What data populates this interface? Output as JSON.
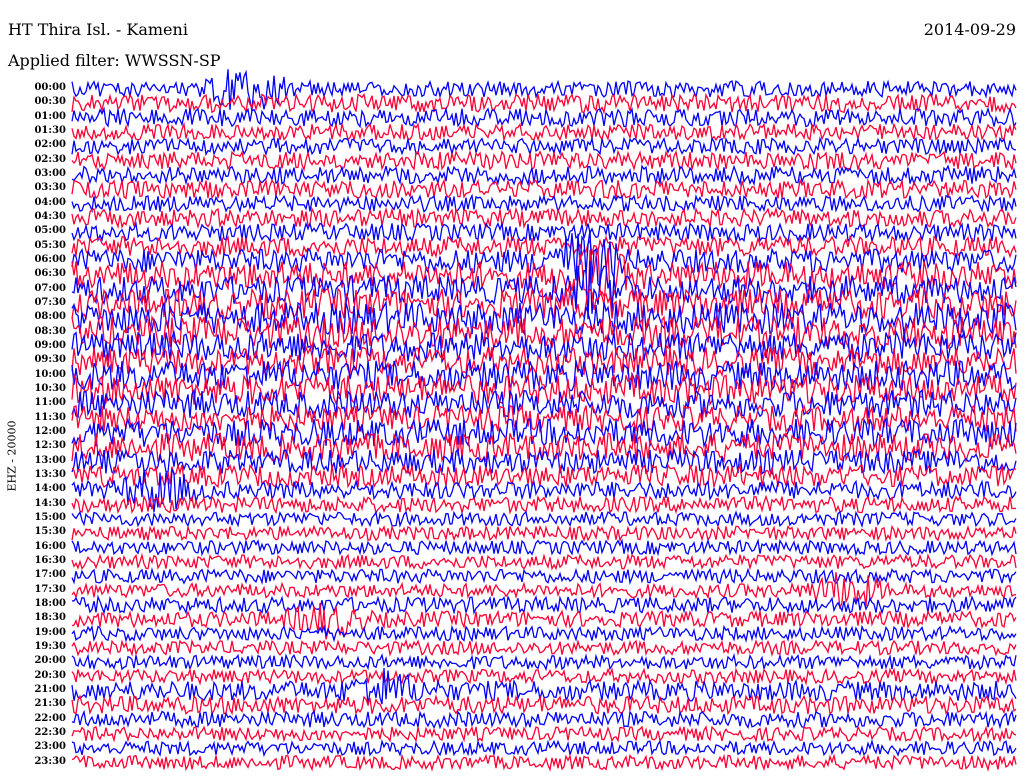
{
  "header": {
    "station": "HT Thira Isl. - Kameni",
    "date": "2014-09-29",
    "filter": "Applied filter: WWSSN-SP",
    "channel": "EHZ - 20000"
  },
  "chart_data": {
    "type": "line",
    "title": "HT Thira Isl. - Kameni",
    "row_labels": [
      "00:00",
      "00:30",
      "01:00",
      "01:30",
      "02:00",
      "02:30",
      "03:00",
      "03:30",
      "04:00",
      "04:30",
      "05:00",
      "05:30",
      "06:00",
      "06:30",
      "07:00",
      "07:30",
      "08:00",
      "08:30",
      "09:00",
      "09:30",
      "10:00",
      "10:30",
      "11:00",
      "11:30",
      "12:00",
      "12:30",
      "13:00",
      "13:30",
      "14:00",
      "14:30",
      "15:00",
      "15:30",
      "16:00",
      "16:30",
      "17:00",
      "17:30",
      "18:00",
      "18:30",
      "19:00",
      "19:30",
      "20:00",
      "20:30",
      "21:00",
      "21:30",
      "22:00",
      "22:30",
      "23:00",
      "23:30"
    ],
    "colors": [
      "#0000ff",
      "#ff0033"
    ],
    "row_amplitude": [
      8,
      9,
      9,
      8,
      8,
      9,
      9,
      9,
      8,
      9,
      9,
      10,
      12,
      14,
      14,
      15,
      16,
      16,
      15,
      14,
      15,
      15,
      14,
      13,
      14,
      14,
      12,
      11,
      9,
      8,
      7,
      7,
      7,
      7,
      7,
      7,
      8,
      8,
      7,
      7,
      7,
      7,
      10,
      9,
      8,
      7,
      7,
      7
    ],
    "events": [
      {
        "row": 0,
        "x": 0.185,
        "amp": 3.5
      },
      {
        "row": 12,
        "x": 0.54,
        "amp": 3
      },
      {
        "row": 13,
        "x": 0.55,
        "amp": 2.6
      },
      {
        "row": 14,
        "x": 0.55,
        "amp": 2.2
      },
      {
        "row": 28,
        "x": 0.09,
        "amp": 3
      },
      {
        "row": 35,
        "x": 0.82,
        "amp": 3.2
      },
      {
        "row": 37,
        "x": 0.27,
        "amp": 2.6
      },
      {
        "row": 42,
        "x": 0.33,
        "amp": 2.4
      }
    ]
  }
}
